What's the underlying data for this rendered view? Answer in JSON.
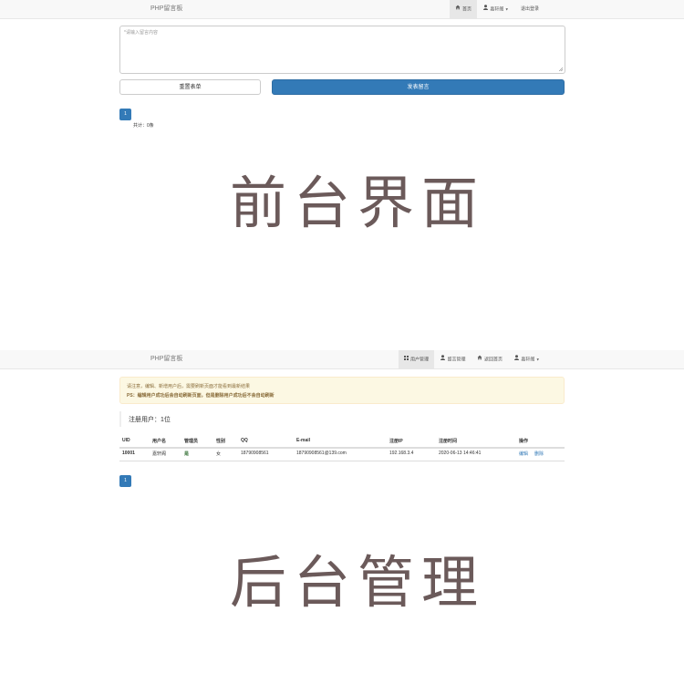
{
  "front": {
    "brand": "PHP留言板",
    "nav": {
      "home": "首页",
      "user": "嘉轩阁",
      "logout": "退出登录"
    },
    "textarea_placeholder": "*请输入留言内容",
    "reset_button": "重置表单",
    "submit_button": "发表留言",
    "page": "1",
    "total": "共计：0条",
    "caption": "前台界面"
  },
  "admin": {
    "brand": "PHP留言板",
    "nav": {
      "users": "用户管理",
      "messages": "留言管理",
      "back": "返回首页",
      "user": "嘉轩阁"
    },
    "alert": {
      "line1": "请注意，编辑、新增用户后，需要刷新页面才能看到最新结果",
      "line2": "PS：编辑用户成功后会自动刷新页面，但是删除用户成功后不会自动刷新"
    },
    "registered": "注册用户：1位",
    "table": {
      "headers": [
        "UID",
        "用户名",
        "管理员",
        "性别",
        "QQ",
        "E-mail",
        "注册IP",
        "注册时间",
        "操作"
      ],
      "row": {
        "uid": "10001",
        "username": "嘉轩阁",
        "admin": "是",
        "gender": "女",
        "qq": "18790908561",
        "email": "18790908561@139.com",
        "ip": "192.168.3.4",
        "time": "2020-06-13 14:46:41",
        "edit": "编辑",
        "delete": "删除"
      }
    },
    "page": "1",
    "caption": "后台管理"
  },
  "colors": {
    "primary": "#337ab7",
    "success": "#3c763d",
    "caption": "#6b5a5a",
    "alert_bg": "#fcf8e3",
    "alert_text": "#8a6d3b"
  }
}
